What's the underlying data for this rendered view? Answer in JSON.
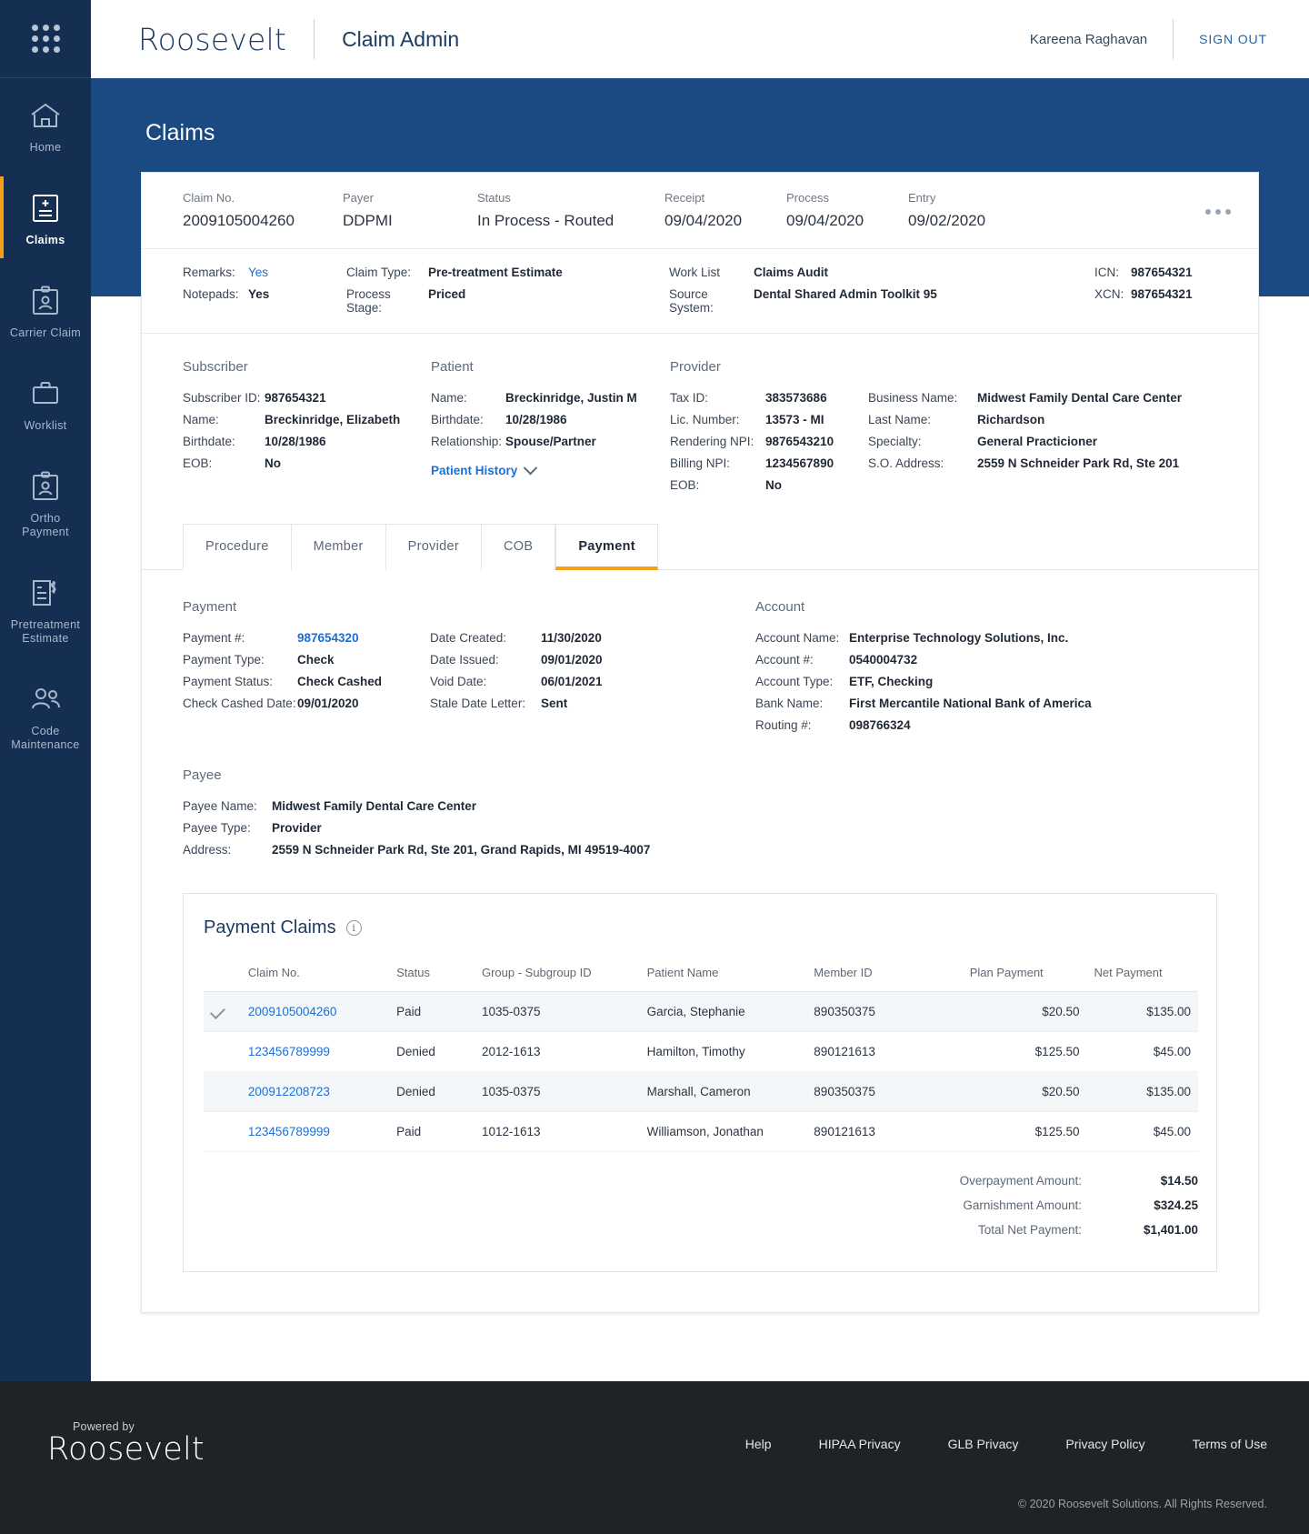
{
  "topbar": {
    "brand": "Roosevelt",
    "app_title": "Claim Admin",
    "user_name": "Kareena Raghavan",
    "sign_out": "SIGN OUT"
  },
  "sidebar": {
    "apps_icon": "apps-grid-icon",
    "items": [
      {
        "label": "Home",
        "icon": "home-icon",
        "active": false
      },
      {
        "label": "Claims",
        "icon": "claims-document-icon",
        "active": true
      },
      {
        "label": "Carrier Claim",
        "icon": "carrier-claim-person-icon",
        "active": false
      },
      {
        "label": "Worklist",
        "icon": "briefcase-icon",
        "active": false
      },
      {
        "label": "Ortho\nPayment",
        "icon": "ortho-payment-person-icon",
        "active": false
      },
      {
        "label": "Pretreatment\nEstimate",
        "icon": "pretreatment-estimate-icon",
        "active": false
      },
      {
        "label": "Code\nMaintenance",
        "icon": "code-maintenance-people-icon",
        "active": false
      }
    ]
  },
  "page": {
    "title": "Claims"
  },
  "claim_summary": [
    {
      "label": "Claim  No.",
      "value": "2009105004260"
    },
    {
      "label": "Payer",
      "value": "DDPMI"
    },
    {
      "label": "Status",
      "value": "In Process - Routed"
    },
    {
      "label": "Receipt",
      "value": "09/04/2020"
    },
    {
      "label": "Process",
      "value": "09/04/2020"
    },
    {
      "label": "Entry",
      "value": "09/02/2020"
    }
  ],
  "claim_meta": {
    "col1": [
      {
        "k": "Remarks:",
        "v": "Yes",
        "link": true
      },
      {
        "k": "Notepads:",
        "v": "Yes",
        "link": false
      }
    ],
    "col2": [
      {
        "k": "Claim Type:",
        "v": "Pre-treatment Estimate"
      },
      {
        "k": "Process Stage:",
        "v": "Priced"
      }
    ],
    "col3": [
      {
        "k": "Work List",
        "v": "Claims Audit"
      },
      {
        "k": "Source System:",
        "v": "Dental Shared Admin Toolkit 95"
      }
    ],
    "col4": [
      {
        "k": "ICN:",
        "v": "987654321"
      },
      {
        "k": "XCN:",
        "v": "987654321"
      }
    ]
  },
  "subscriber": {
    "title": "Subscriber",
    "rows": [
      {
        "k": "Subscriber ID:",
        "v": "987654321"
      },
      {
        "k": "Name:",
        "v": "Breckinridge, Elizabeth"
      },
      {
        "k": "Birthdate:",
        "v": "10/28/1986"
      },
      {
        "k": "EOB:",
        "v": "No"
      }
    ]
  },
  "patient": {
    "title": "Patient",
    "rows": [
      {
        "k": "Name:",
        "v": "Breckinridge, Justin M"
      },
      {
        "k": "Birthdate:",
        "v": "10/28/1986"
      },
      {
        "k": "Relationship:",
        "v": "Spouse/Partner"
      }
    ],
    "history_link": "Patient History"
  },
  "provider": {
    "title": "Provider",
    "left_rows": [
      {
        "k": "Tax ID:",
        "v": "383573686"
      },
      {
        "k": "Lic. Number:",
        "v": "13573 - MI"
      },
      {
        "k": "Rendering NPI:",
        "v": "9876543210"
      },
      {
        "k": "Billing NPI:",
        "v": "1234567890"
      },
      {
        "k": "EOB:",
        "v": "No"
      }
    ],
    "right_rows": [
      {
        "k": "Business Name:",
        "v": "Midwest Family Dental Care Center"
      },
      {
        "k": "Last Name:",
        "v": "Richardson"
      },
      {
        "k": "Specialty:",
        "v": "General Practicioner"
      },
      {
        "k": "S.O. Address:",
        "v": "2559 N Schneider Park Rd, Ste 201"
      }
    ]
  },
  "tabs": [
    {
      "label": "Procedure",
      "active": false
    },
    {
      "label": "Member",
      "active": false
    },
    {
      "label": "Provider",
      "active": false
    },
    {
      "label": "COB",
      "active": false
    },
    {
      "label": "Payment",
      "active": true
    }
  ],
  "payment": {
    "title": "Payment",
    "left_rows": [
      {
        "k": "Payment #:",
        "v": "987654320",
        "link": true
      },
      {
        "k": "Payment Type:",
        "v": "Check",
        "link": false
      },
      {
        "k": "Payment Status:",
        "v": "Check Cashed",
        "link": false
      },
      {
        "k": "Check Cashed Date:",
        "v": "09/01/2020",
        "link": false
      }
    ],
    "mid_rows": [
      {
        "k": "Date Created:",
        "v": "11/30/2020"
      },
      {
        "k": "Date Issued:",
        "v": "09/01/2020"
      },
      {
        "k": "Void Date:",
        "v": "06/01/2021"
      },
      {
        "k": "Stale Date Letter:",
        "v": "Sent"
      }
    ]
  },
  "account": {
    "title": "Account",
    "rows": [
      {
        "k": "Account Name:",
        "v": "Enterprise Technology Solutions, Inc."
      },
      {
        "k": "Account #:",
        "v": "0540004732"
      },
      {
        "k": "Account Type:",
        "v": "ETF, Checking"
      },
      {
        "k": "Bank Name:",
        "v": "First Mercantile National Bank of America"
      },
      {
        "k": "Routing #:",
        "v": "098766324"
      }
    ]
  },
  "payee": {
    "title": "Payee",
    "rows": [
      {
        "k": "Payee Name:",
        "v": "Midwest Family Dental Care Center"
      },
      {
        "k": "Payee Type:",
        "v": "Provider"
      },
      {
        "k": "Address:",
        "v": "2559 N Schneider Park Rd, Ste 201, Grand Rapids, MI 49519-4007"
      }
    ]
  },
  "payment_claims": {
    "title": "Payment Claims",
    "info_icon": "info-icon",
    "columns": [
      "Claim No.",
      "Status",
      "Group - Subgroup ID",
      "Patient Name",
      "Member ID",
      "Plan Payment",
      "Net Payment"
    ],
    "rows": [
      {
        "selected": true,
        "claim_no": "2009105004260",
        "status": "Paid",
        "group": "1035-0375",
        "patient": "Garcia, Stephanie",
        "member": "890350375",
        "plan": "$20.50",
        "net": "$135.00"
      },
      {
        "selected": false,
        "claim_no": "123456789999",
        "status": "Denied",
        "group": "2012-1613",
        "patient": "Hamilton, Timothy",
        "member": "890121613",
        "plan": "$125.50",
        "net": "$45.00"
      },
      {
        "selected": false,
        "claim_no": "200912208723",
        "status": "Denied",
        "group": "1035-0375",
        "patient": "Marshall, Cameron",
        "member": "890350375",
        "plan": "$20.50",
        "net": "$135.00"
      },
      {
        "selected": false,
        "claim_no": "123456789999",
        "status": "Paid",
        "group": "1012-1613",
        "patient": "Williamson, Jonathan",
        "member": "890121613",
        "plan": "$125.50",
        "net": "$45.00"
      }
    ],
    "totals": [
      {
        "label": "Overpayment Amount:",
        "value": "$14.50"
      },
      {
        "label": "Garnishment Amount:",
        "value": "$324.25"
      },
      {
        "label": "Total Net Payment:",
        "value": "$1,401.00"
      }
    ]
  },
  "footer": {
    "powered_by": "Powered by",
    "brand": "Roosevelt",
    "links": [
      "Help",
      "HIPAA Privacy",
      "GLB Privacy",
      "Privacy Policy",
      "Terms of Use"
    ],
    "copyright": "© 2020 Roosevelt Solutions. All Rights Reserved."
  }
}
